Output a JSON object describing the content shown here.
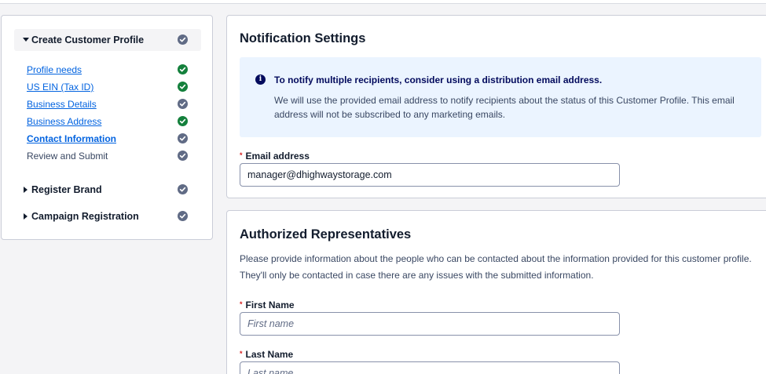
{
  "sidebar": {
    "sections": [
      {
        "title": "Create Customer Profile",
        "expanded": true,
        "status": "gray"
      },
      {
        "title": "Register Brand",
        "expanded": false,
        "status": "gray"
      },
      {
        "title": "Campaign Registration",
        "expanded": false,
        "status": "gray"
      }
    ],
    "steps": [
      {
        "label": "Profile needs",
        "status": "green"
      },
      {
        "label": "US EIN (Tax ID)",
        "status": "green"
      },
      {
        "label": "Business Details",
        "status": "gray"
      },
      {
        "label": "Business Address",
        "status": "green"
      },
      {
        "label": "Contact Information",
        "status": "gray"
      },
      {
        "label": "Review and Submit",
        "status": "gray"
      }
    ]
  },
  "notification": {
    "heading": "Notification Settings",
    "info_title": "To notify multiple recipients, consider using a distribution email address.",
    "info_body": "We will use the provided email address to notify recipients about the status of this Customer Profile. This email address will not be subscribed to any marketing emails.",
    "email_label": "Email address",
    "email_value": "manager@dhighwaystorage.com"
  },
  "representatives": {
    "heading": "Authorized Representatives",
    "description": "Please provide information about the people who can be contacted about the information provided for this customer profile. They'll only be contacted in case there are any issues with the submitted information.",
    "first_name_label": "First Name",
    "first_name_placeholder": "First name",
    "last_name_label": "Last Name",
    "last_name_placeholder": "Last name"
  },
  "required_marker": "*",
  "colors": {
    "green": "#14803c",
    "gray": "#606b85",
    "link": "#0263e0",
    "info_bg": "#ebf4ff"
  }
}
